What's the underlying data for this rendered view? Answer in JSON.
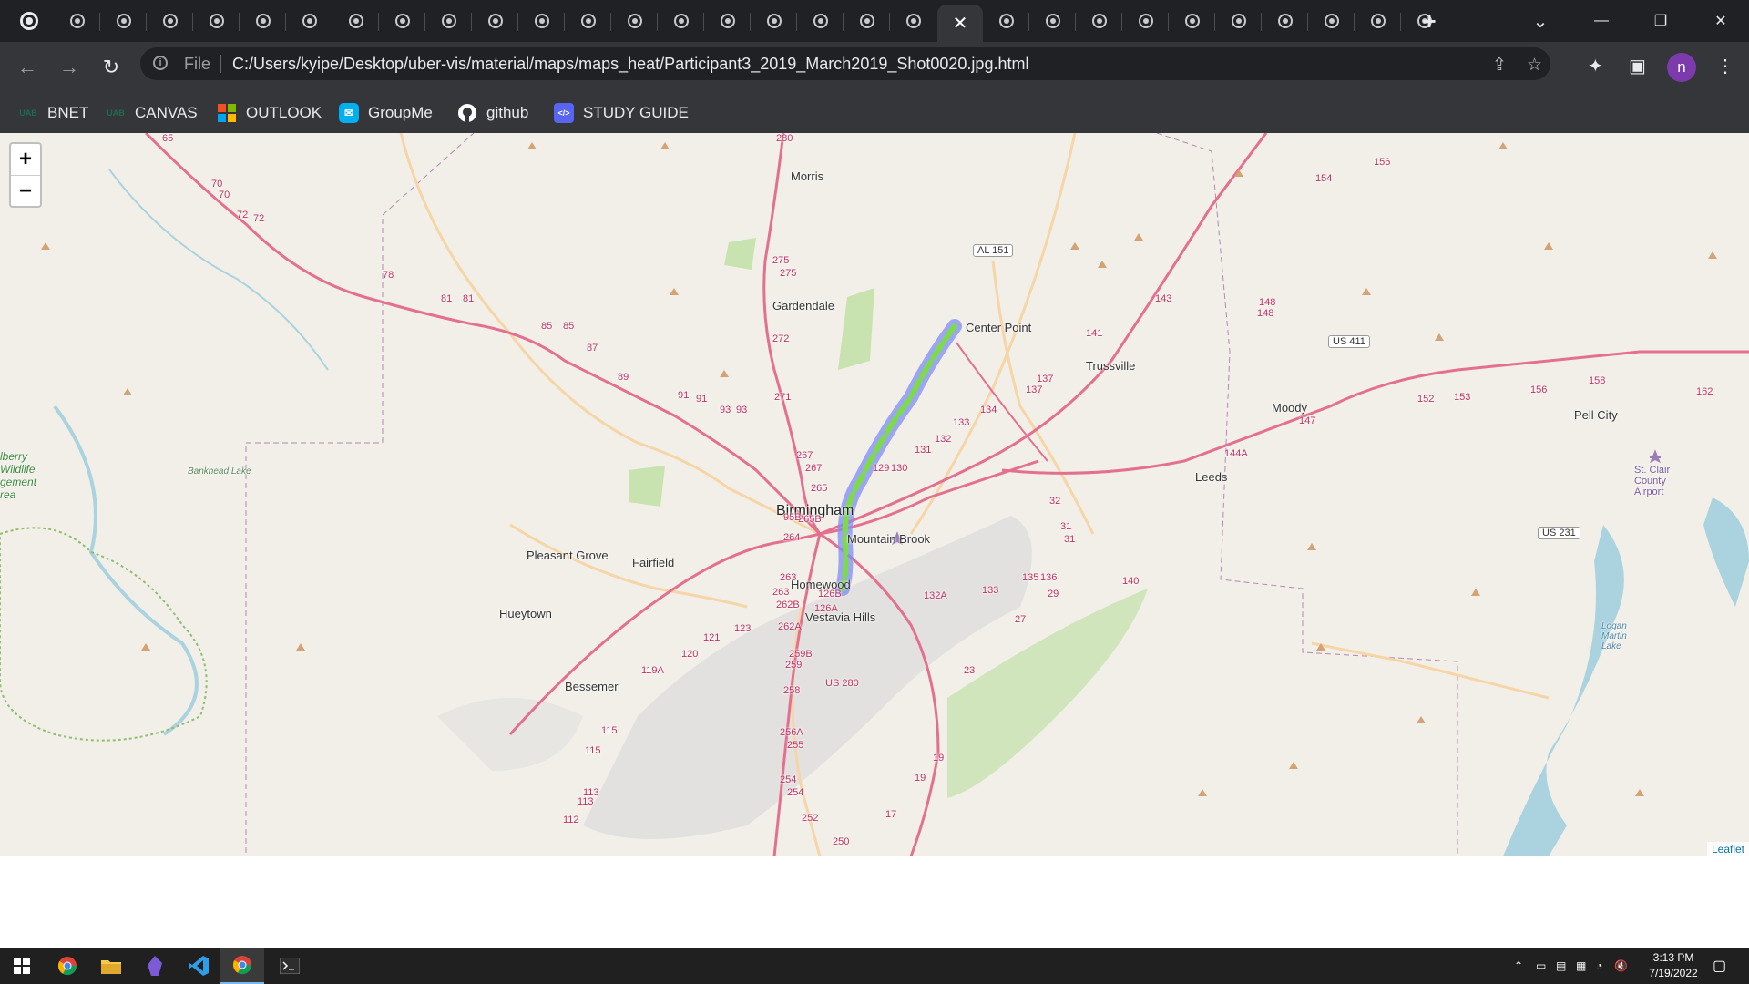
{
  "browser": {
    "tab_count": 30,
    "active_tab_index": 19,
    "close_glyph": "✕",
    "new_tab_glyph": "+",
    "dropdown_glyph": "⌄",
    "window_controls": [
      "—",
      "❐",
      "✕"
    ]
  },
  "toolbar": {
    "back_glyph": "←",
    "forward_glyph": "→",
    "reload_glyph": "↻",
    "scheme_label": "File",
    "url": "C:/Users/kyipe/Desktop/uber-vis/material/maps/maps_heat/Participant3_2019_March2019_Shot0020.jpg.html",
    "share_glyph": "⇪",
    "star_glyph": "☆",
    "extensions_glyph": "✦",
    "sidepanel_glyph": "▣",
    "avatar_letter": "n",
    "menu_glyph": "⋮"
  },
  "bookmarks": [
    {
      "label": "BNET",
      "icon": "uab-icon",
      "icon_text": "UAB",
      "color": "#1e6b52"
    },
    {
      "label": "CANVAS",
      "icon": "uab-icon",
      "icon_text": "UAB",
      "color": "#1e6b52"
    },
    {
      "label": "OUTLOOK",
      "icon": "microsoft-icon",
      "icon_text": "",
      "color": "#f25022"
    },
    {
      "label": "GroupMe",
      "icon": "groupme-icon",
      "icon_text": "✉",
      "color": "#00aff0"
    },
    {
      "label": "github",
      "icon": "github-icon",
      "icon_text": "●",
      "color": "#ffffff"
    },
    {
      "label": "STUDY GUIDE",
      "icon": "code-icon",
      "icon_text": "</>",
      "color": "#5865f2"
    }
  ],
  "map": {
    "zoom_in": "+",
    "zoom_out": "−",
    "attribution": "Leaflet",
    "places": [
      "Morris",
      "Gardendale",
      "Center Point",
      "Trussville",
      "Moody",
      "Pell City",
      "Leeds",
      "Birmingham",
      "Mountain Brook",
      "Pleasant Grove",
      "Fairfield",
      "Homewood",
      "Hueytown",
      "Vestavia Hills",
      "Bessemer",
      "Bankhead Lake",
      "St. Clair County Airport",
      "Logan Martin Lake",
      "lberry Wildlife gement rea"
    ],
    "shields": [
      "AL 151",
      "US 411",
      "US 231",
      "US 280"
    ],
    "route_numbers": [
      "65",
      "70",
      "70",
      "72",
      "72",
      "78",
      "81",
      "81",
      "85",
      "85",
      "87",
      "89",
      "91",
      "91",
      "93",
      "93",
      "280",
      "275",
      "275",
      "272",
      "271",
      "267",
      "267",
      "265",
      "265B",
      "264",
      "263",
      "263",
      "262B",
      "262A",
      "126B",
      "126A",
      "95B",
      "129",
      "130",
      "131",
      "132",
      "133",
      "134",
      "137",
      "137",
      "141",
      "143",
      "147",
      "148",
      "148",
      "144A",
      "152",
      "153",
      "156",
      "158",
      "162",
      "154",
      "156",
      "132A",
      "133",
      "135",
      "136",
      "140",
      "32",
      "31",
      "31",
      "29",
      "27",
      "23",
      "19",
      "19",
      "17",
      "123",
      "121",
      "120",
      "119A",
      "115",
      "115",
      "113",
      "113",
      "112",
      "259B",
      "259",
      "258",
      "256A",
      "255",
      "254",
      "254",
      "252",
      "250"
    ],
    "colors": {
      "land": "#f2efe9",
      "motorway": "#e4708f",
      "trunk": "#f5b971",
      "urban": "#dcdcdc",
      "forest": "#c8e2b0",
      "water": "#aad3df",
      "heat_outer": "#7f8cf5",
      "heat_inner": "#7ddb4a"
    }
  },
  "taskbar": {
    "apps": [
      "windows-start-icon",
      "chrome-icon",
      "file-explorer-icon",
      "obsidian-icon",
      "vscode-icon",
      "chrome-active-icon",
      "terminal-icon"
    ],
    "tray_glyphs": [
      "⌃",
      "▭",
      "▤",
      "▦",
      "◔",
      "🔇"
    ],
    "time": "3:13 PM",
    "date": "7/19/2022",
    "notification_glyph": "▢"
  }
}
